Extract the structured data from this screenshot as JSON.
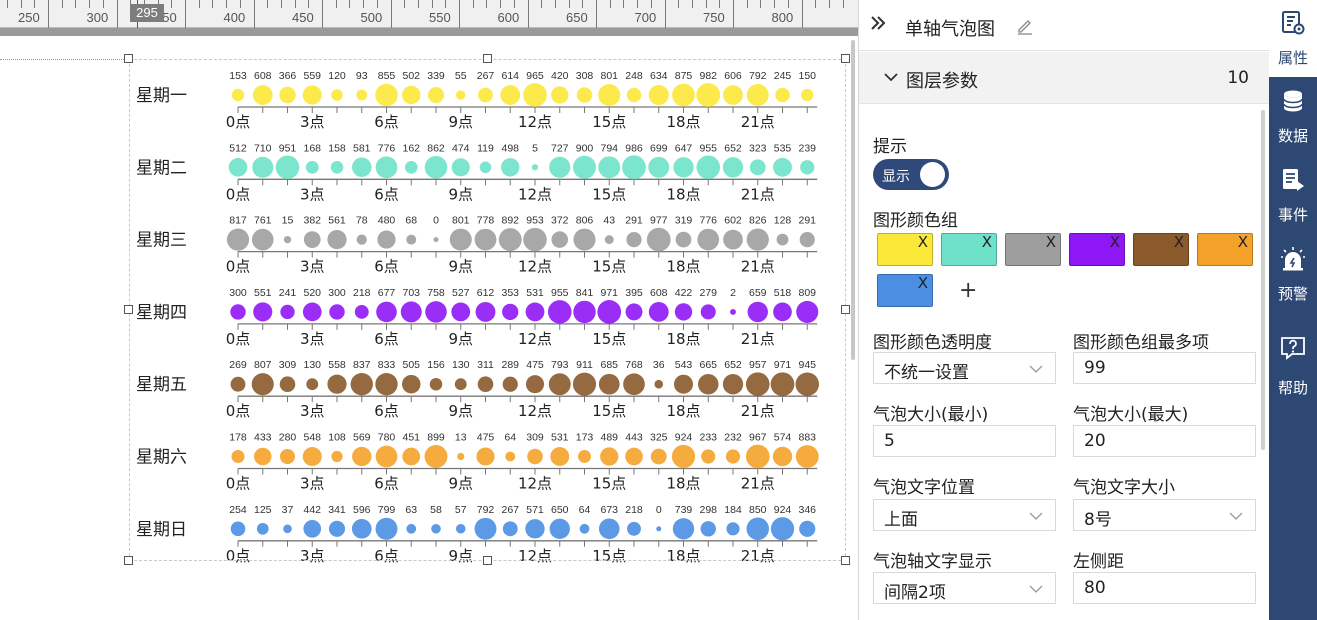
{
  "ruler": {
    "labels": [
      "250",
      "300",
      "350",
      "400",
      "450",
      "500",
      "550",
      "600",
      "650",
      "700",
      "750",
      "800"
    ],
    "marker": "295"
  },
  "panel": {
    "title": "单轴气泡图",
    "section_title": "图层参数",
    "section_count": "10",
    "tooltip_label": "提示",
    "tooltip_toggle": "显示",
    "color_group_label": "图形颜色组",
    "remove_glyph": "X",
    "add_glyph": "+",
    "color_group": [
      "#fce839",
      "#6ee2c8",
      "#9e9e9e",
      "#8f16f5",
      "#8b5a2b",
      "#f5a22a",
      "#4a8fe2"
    ],
    "opacity_label": "图形颜色透明度",
    "opacity_value": "不统一设置",
    "max_items_label": "图形颜色组最多项",
    "max_items_value": "99",
    "bubble_min_label": "气泡大小(最小)",
    "bubble_min_value": "5",
    "bubble_max_label": "气泡大小(最大)",
    "bubble_max_value": "20",
    "text_pos_label": "气泡文字位置",
    "text_pos_value": "上面",
    "text_size_label": "气泡文字大小",
    "text_size_value": "8号",
    "axis_text_label": "气泡轴文字显示",
    "axis_text_value": "间隔2项",
    "left_margin_label": "左侧距",
    "left_margin_value": "80"
  },
  "nav": {
    "items": [
      {
        "label": "属性",
        "icon": "properties-icon"
      },
      {
        "label": "数据",
        "icon": "database-icon"
      },
      {
        "label": "事件",
        "icon": "event-icon"
      },
      {
        "label": "预警",
        "icon": "alarm-icon"
      },
      {
        "label": "帮助",
        "icon": "help-icon"
      }
    ]
  },
  "chart_data": {
    "type": "scatter",
    "subtype": "single-axis-bubble",
    "x_tick_labels": [
      "0点",
      "3点",
      "6点",
      "9点",
      "12点",
      "15点",
      "18点",
      "21点"
    ],
    "x_hours": 24,
    "size_range": [
      0,
      1000
    ],
    "series": [
      {
        "name": "星期一",
        "color": "#fce839",
        "values": [
          153,
          608,
          366,
          559,
          120,
          93,
          855,
          502,
          339,
          55,
          267,
          614,
          965,
          420,
          308,
          801,
          248,
          634,
          875,
          982,
          606,
          792,
          245,
          150
        ]
      },
      {
        "name": "星期二",
        "color": "#6ee2c8",
        "values": [
          512,
          710,
          951,
          168,
          158,
          581,
          776,
          162,
          862,
          474,
          119,
          498,
          5,
          727,
          900,
          794,
          986,
          699,
          647,
          955,
          652,
          323,
          535,
          239
        ]
      },
      {
        "name": "星期三",
        "color": "#9e9e9e",
        "values": [
          817,
          761,
          15,
          382,
          561,
          78,
          480,
          68,
          0,
          801,
          778,
          892,
          953,
          372,
          806,
          43,
          291,
          977,
          319,
          776,
          602,
          826,
          128,
          291
        ]
      },
      {
        "name": "星期四",
        "color": "#8f16f5",
        "values": [
          300,
          551,
          241,
          520,
          300,
          218,
          677,
          703,
          758,
          527,
          612,
          353,
          531,
          955,
          841,
          971,
          395,
          608,
          422,
          279,
          2,
          659,
          518,
          809
        ]
      },
      {
        "name": "星期五",
        "color": "#8b5a2b",
        "values": [
          269,
          807,
          309,
          130,
          558,
          837,
          833,
          505,
          156,
          130,
          311,
          289,
          475,
          793,
          911,
          685,
          768,
          36,
          543,
          665,
          652,
          957,
          971,
          945
        ]
      },
      {
        "name": "星期六",
        "color": "#f5a22a",
        "values": [
          178,
          433,
          280,
          548,
          108,
          569,
          780,
          451,
          899,
          13,
          475,
          64,
          309,
          531,
          173,
          489,
          443,
          325,
          924,
          233,
          232,
          967,
          574,
          883
        ]
      },
      {
        "name": "星期日",
        "color": "#4a8fe2",
        "values": [
          254,
          125,
          37,
          442,
          341,
          596,
          799,
          63,
          58,
          57,
          792,
          267,
          571,
          650,
          64,
          673,
          218,
          0,
          739,
          298,
          184,
          850,
          924,
          346
        ]
      }
    ]
  }
}
